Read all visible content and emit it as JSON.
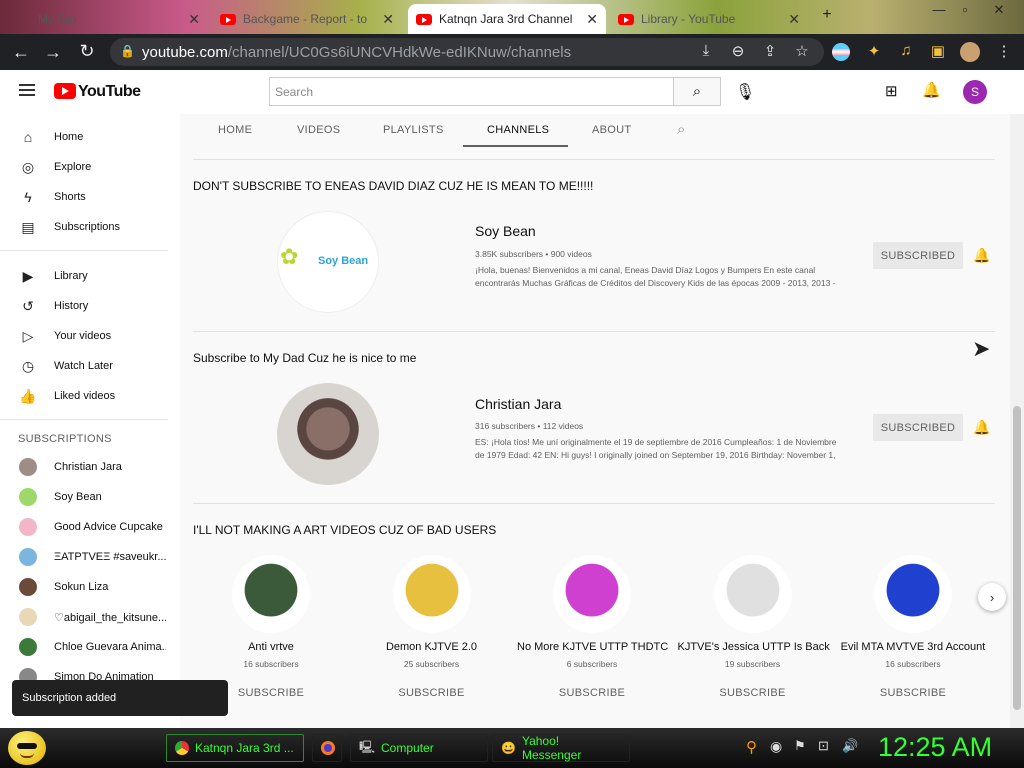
{
  "browser": {
    "tabs": [
      {
        "label": "My Tab",
        "active": false
      },
      {
        "label": "Backgame - Report - to",
        "active": false
      },
      {
        "label": "Katnqn Jara 3rd Channel",
        "active": true
      },
      {
        "label": "Library - YouTube",
        "active": false
      }
    ],
    "url_host": "youtube.com",
    "url_path": "/channel/UC0Gs6iUNCVHdkWe-edIKNuw/channels",
    "window_controls": [
      "minimize-icon",
      "maximize-icon",
      "close-icon"
    ]
  },
  "youtube": {
    "logo_text": "YouTube",
    "search_placeholder": "Search",
    "avatar_letter": "S",
    "brand_color": "#ff0000",
    "avatar_color": "#9c27b0"
  },
  "sidebar": {
    "main": [
      {
        "label": "Home",
        "icon": "home-icon"
      },
      {
        "label": "Explore",
        "icon": "compass-icon"
      },
      {
        "label": "Shorts",
        "icon": "shorts-icon"
      },
      {
        "label": "Subscriptions",
        "icon": "subscriptions-icon"
      }
    ],
    "library": [
      {
        "label": "Library",
        "icon": "library-icon"
      },
      {
        "label": "History",
        "icon": "history-icon"
      },
      {
        "label": "Your videos",
        "icon": "your-videos-icon"
      },
      {
        "label": "Watch Later",
        "icon": "clock-icon"
      },
      {
        "label": "Liked videos",
        "icon": "thumbs-up-icon"
      }
    ],
    "subs_heading": "SUBSCRIPTIONS",
    "subs": [
      {
        "label": "Christian Jara",
        "color": "#9e8c86"
      },
      {
        "label": "Soy Bean",
        "color": "#9fd86a"
      },
      {
        "label": "Good Advice Cupcake",
        "color": "#f3b6c8"
      },
      {
        "label": "ΞATPTVEΞ #saveukr...",
        "color": "#7ab6e0"
      },
      {
        "label": "Sokun Liza",
        "color": "#6b4a3a"
      },
      {
        "label": "♡abigail_the_kitsune...",
        "color": "#e8d8b8"
      },
      {
        "label": "Chloe Guevara Anima...",
        "color": "#3b7a3b"
      },
      {
        "label": "Simon Do Animation",
        "color": "#888888"
      }
    ]
  },
  "channel_tabs": [
    "HOME",
    "VIDEOS",
    "PLAYLISTS",
    "CHANNELS",
    "ABOUT"
  ],
  "active_tab": "CHANNELS",
  "shelves": [
    {
      "title": "DON'T SUBSCRIBE TO ENEAS DAVID DIAZ CUZ HE IS MEAN TO ME!!!!!",
      "channel": "Soy Bean",
      "meta": "3.85K subscribers • 900 videos",
      "desc1": "¡Hola, buenas! Bienvenidos a mi canal, Eneas David Díaz Logos y Bumpers En este canal",
      "desc2": "encontrarás Muchas Gráficas de Créditos del Discovery Kids de las épocas 2009 - 2013, 2013 -",
      "logo_text": "Soy Bean",
      "button": "SUBSCRIBED"
    },
    {
      "title": "Subscribe to My Dad Cuz he is nice to me",
      "channel": "Christian Jara",
      "meta": "316 subscribers • 112 videos",
      "desc1": "ES: ¡Hola tíos! Me uní originalmente el 19 de septiembre de 2016 Cumpleaños: 1 de Noviembre",
      "desc2": "de 1979 Edad: 42 EN: Hi guys! I originally joined on September 19, 2016 Birthday: November 1,",
      "button": "SUBSCRIBED"
    }
  ],
  "grid_shelf": {
    "title": "I'LL NOT MAKING A ART VIDEOS CUZ OF BAD USERS",
    "channels": [
      {
        "name": "Anti vrtve",
        "subs": "16 subscribers",
        "button": "SUBSCRIBE",
        "color": "#3a5a3a"
      },
      {
        "name": "Demon KJTVE 2.0",
        "subs": "25 subscribers",
        "button": "SUBSCRIBE",
        "color": "#e8c040"
      },
      {
        "name": "No More KJTVE UTTP THDTC",
        "subs": "6 subscribers",
        "button": "SUBSCRIBE",
        "color": "#d040d0"
      },
      {
        "name": "KJTVE's Jessica UTTP Is Back",
        "subs": "19 subscribers",
        "button": "SUBSCRIBE",
        "color": "#e0e0e0"
      },
      {
        "name": "Evil MTA MVTVE 3rd Account",
        "subs": "16 subscribers",
        "button": "SUBSCRIBE",
        "color": "#2040d0"
      }
    ]
  },
  "toast": "Subscription added",
  "taskbar": {
    "tasks": [
      "Katnqn Jara 3rd ...",
      "Computer",
      "Yahoo! Messenger"
    ],
    "clock": "12:25 AM",
    "clock_color": "#33ff33"
  }
}
